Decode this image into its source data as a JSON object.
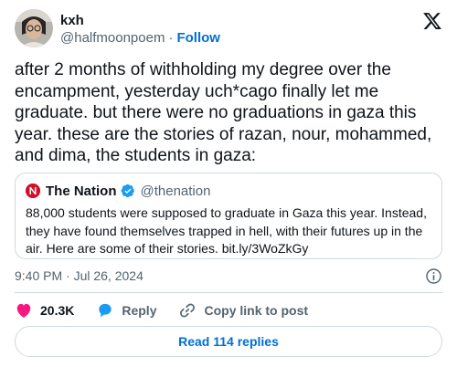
{
  "author": {
    "name": "kxh",
    "handle": "@halfmoonpoem",
    "separator": "·",
    "follow_label": "Follow"
  },
  "tweet": {
    "text": "after 2 months of withholding my degree over the encampment, yesterday uch*cago finally let me graduate. but there were no graduations in gaza this year. these are the stories of razan, nour, mohammed, and dima, the students in gaza:",
    "timestamp": "9:40 PM · Jul 26, 2024"
  },
  "quote": {
    "name": "The Nation",
    "handle": "@thenation",
    "text": "88,000 students were supposed to graduate in Gaza this year. Instead, they have found themselves trapped in hell, with their futures up in the air. Here are some of their stories. bit.ly/3WoZkGy",
    "logo_color": "#d0102b"
  },
  "actions": {
    "likes": "20.3K",
    "reply_label": "Reply",
    "copy_label": "Copy link to post"
  },
  "replies": {
    "label": "Read 114 replies"
  },
  "icons": [
    "x-logo-icon",
    "verified-badge-icon",
    "info-icon",
    "heart-icon",
    "reply-bubble-icon",
    "link-icon"
  ],
  "colors": {
    "accent": "#006fd6",
    "like": "#f91880",
    "reply": "#1d9bf0",
    "border": "#cfd9de",
    "muted": "#536471"
  }
}
